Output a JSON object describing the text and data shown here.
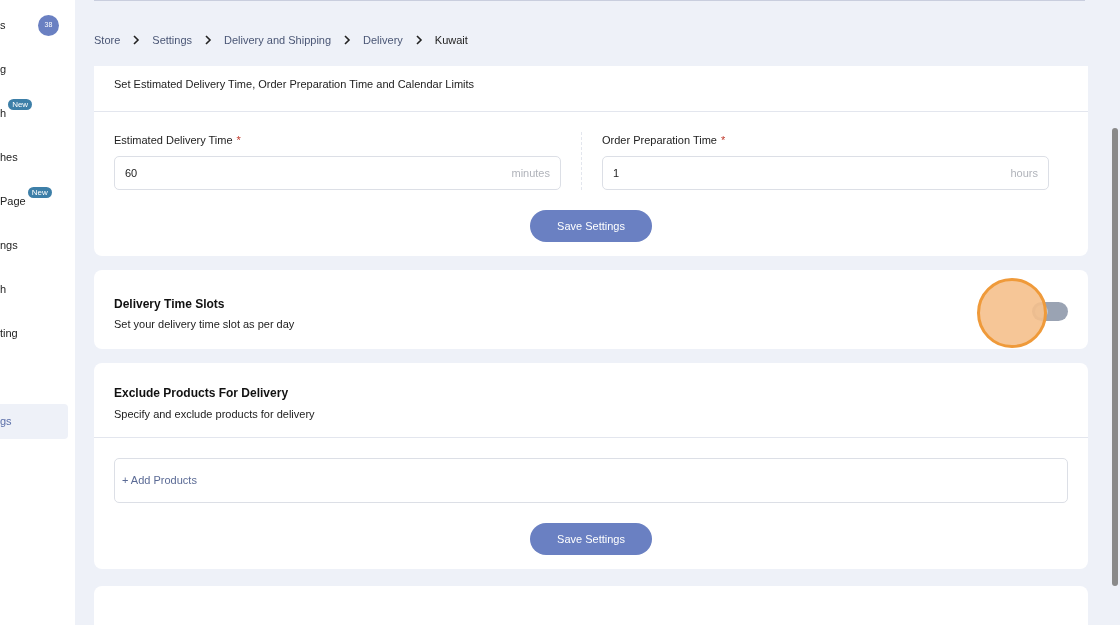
{
  "sidebar": {
    "items": [
      {
        "kind": "item",
        "label": "s",
        "badge": "38",
        "selected": false
      },
      {
        "kind": "item",
        "label": "g",
        "selected": false
      },
      {
        "kind": "item",
        "label": "h",
        "tag": "New",
        "selected": false
      },
      {
        "kind": "item",
        "label": "hes",
        "selected": false
      },
      {
        "kind": "item",
        "label": "Page",
        "tag": "New",
        "selected": false
      },
      {
        "kind": "item",
        "label": "ngs",
        "selected": false
      },
      {
        "kind": "item",
        "label": "h",
        "selected": false
      },
      {
        "kind": "item",
        "label": "ting",
        "selected": false
      },
      {
        "kind": "spacer"
      },
      {
        "kind": "item",
        "label": "gs",
        "selected": true
      }
    ]
  },
  "breadcrumb": [
    "Store",
    "Settings",
    "Delivery and Shipping",
    "Delivery",
    "Kuwait"
  ],
  "datetime_card": {
    "description": "Set Estimated Delivery Time, Order Preparation Time and Calendar Limits",
    "fields": [
      {
        "label": "Estimated Delivery Time",
        "required_mark": "*",
        "value": "60",
        "unit": "minutes"
      },
      {
        "label": "Order Preparation Time",
        "required_mark": "*",
        "value": "1",
        "unit": "hours"
      }
    ],
    "button": "Save Settings"
  },
  "time_slots_card": {
    "title": "Delivery Time Slots",
    "description": "Set your delivery time slot as per day",
    "on": false
  },
  "exclude_card": {
    "title": "Exclude Products For Delivery",
    "description": "Specify and exclude products for delivery",
    "add_label": "+ Add Products",
    "button": "Save Settings"
  }
}
